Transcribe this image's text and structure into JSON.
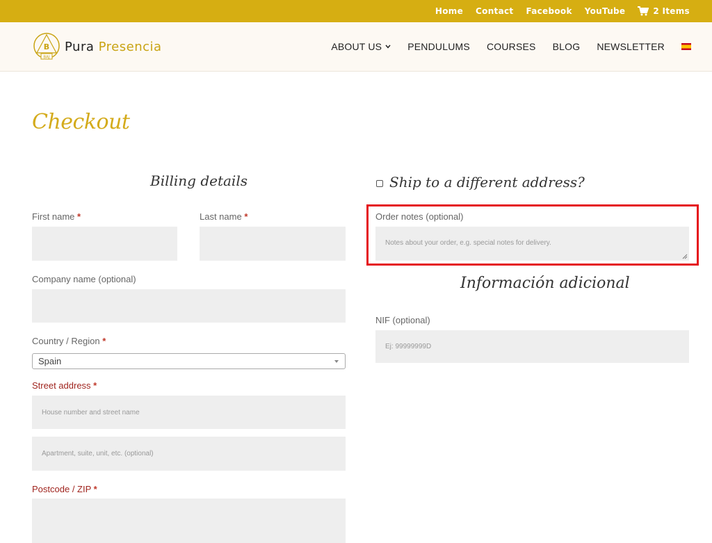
{
  "topbar": {
    "links": [
      "Home",
      "Contact",
      "Facebook",
      "YouTube"
    ],
    "cart_label": "2 Items",
    "cart_icon": "cart-icon"
  },
  "header": {
    "logo_word1": "Pura",
    "logo_word2": "Presencia",
    "nav": [
      "ABOUT US",
      "PENDULUMS",
      "COURSES",
      "BLOG",
      "NEWSLETTER"
    ],
    "language_flag": "spain-flag-icon"
  },
  "page": {
    "title": "Checkout"
  },
  "billing": {
    "heading": "Billing details",
    "first_name_label": "First name",
    "last_name_label": "Last name",
    "company_label": "Company name (optional)",
    "country_label": "Country / Region",
    "country_value": "Spain",
    "street_label": "Street address",
    "street_placeholder_1": "House number and street name",
    "street_placeholder_2": "Apartment, suite, unit, etc. (optional)",
    "postcode_label": "Postcode / ZIP",
    "required_mark": "*"
  },
  "shipping": {
    "heading": "Ship to a different address?",
    "order_notes_label": "Order notes (optional)",
    "order_notes_placeholder": "Notes about your order, e.g. special notes for delivery."
  },
  "additional": {
    "heading": "Información adicional",
    "nif_label": "NIF (optional)",
    "nif_placeholder": "Ej: 99999999D"
  },
  "colors": {
    "brand_gold": "#d6ae12",
    "highlight_red": "#e5131b"
  }
}
